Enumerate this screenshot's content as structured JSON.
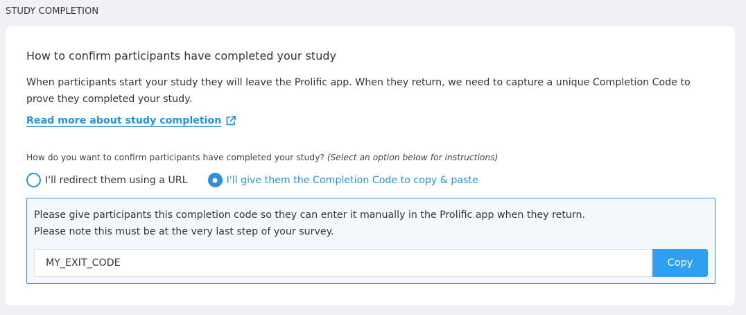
{
  "section": {
    "title": "STUDY COMPLETION"
  },
  "card": {
    "heading": "How to confirm participants have completed your study",
    "description": "When participants start your study they will leave the Prolific app. When they return, we need to capture a unique Completion Code to prove they completed your study.",
    "read_more_link": "Read more about study completion",
    "read_more_icon": "external-link-icon",
    "question": "How do you want to confirm participants have completed your study?",
    "question_hint": "(Select an option below for instructions)",
    "options": [
      {
        "label": "I'll redirect them using a URL",
        "selected": false
      },
      {
        "label": "I'll give them the Completion Code to copy & paste",
        "selected": true
      }
    ],
    "instructions": {
      "line1": "Please give participants this completion code so they can enter it manually in the Prolific app when they return.",
      "line2": "Please note this must be at the very last step of your survey.",
      "code_value": "MY_EXIT_CODE",
      "copy_label": "Copy"
    }
  },
  "colors": {
    "accent": "#2b8fdc",
    "button": "#2ea0f2",
    "page_bg": "#f0f1f5",
    "card_bg": "#ffffff"
  }
}
